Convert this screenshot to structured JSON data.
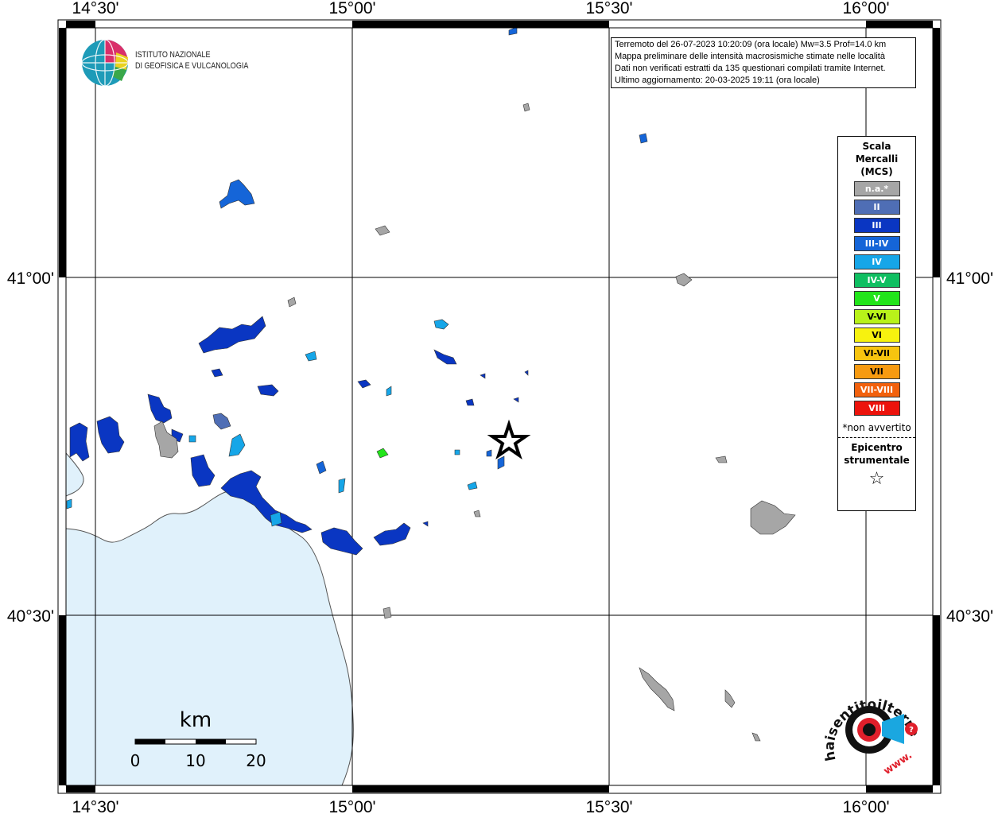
{
  "axes": {
    "lon_ticks": [
      "14°30'",
      "15°00'",
      "15°30'",
      "16°00'"
    ],
    "lat_ticks_left": [
      "41°00'",
      "40°30'"
    ],
    "lat_ticks_right": [
      "41°00'",
      "40°30'"
    ]
  },
  "info_box": {
    "line1": "Terremoto del 26-07-2023 10:20:09 (ora locale) Mw=3.5 Prof=14.0 km",
    "line2": "Mappa preliminare delle intensità macrosismiche stimate nelle località",
    "line3": "Dati non verificati estratti da 135 questionari compilati tramite Internet.",
    "line4": "Ultimo aggiornamento: 20-03-2025 19:11 (ora locale)"
  },
  "logo": {
    "line1": "ISTITUTO NAZIONALE",
    "line2": "DI GEOFISICA E VULCANOLOGIA"
  },
  "legend": {
    "title1": "Scala",
    "title2": "Mercalli",
    "title3": "(MCS)",
    "classes": [
      {
        "label": "n.a.*",
        "color": "#a6a6a6"
      },
      {
        "label": "II",
        "color": "#4f6eb5"
      },
      {
        "label": "III",
        "color": "#0a36c2"
      },
      {
        "label": "III-IV",
        "color": "#1565d8"
      },
      {
        "label": "IV",
        "color": "#16a6e8"
      },
      {
        "label": "IV-V",
        "color": "#0fbf61"
      },
      {
        "label": "V",
        "color": "#22e51a"
      },
      {
        "label": "V-VI",
        "color": "#b8f21a"
      },
      {
        "label": "VI",
        "color": "#f7f20f"
      },
      {
        "label": "VI-VII",
        "color": "#f7c40f"
      },
      {
        "label": "VII",
        "color": "#f79a10"
      },
      {
        "label": "VII-VIII",
        "color": "#f2610d"
      },
      {
        "label": "VIII",
        "color": "#ec130c"
      }
    ],
    "note": "*non avvertito",
    "epicenter1": "Epicentro",
    "epicenter2": "strumentale",
    "star": "☆"
  },
  "scalebar": {
    "unit": "km",
    "labels": [
      "0",
      "10",
      "20"
    ]
  },
  "hsi_logo": {
    "text": "haisentitoilterremoto.it",
    "www": "www."
  },
  "colors": {
    "sea": "#e0f1fb",
    "coast": "#555555",
    "frame": "#000000"
  }
}
